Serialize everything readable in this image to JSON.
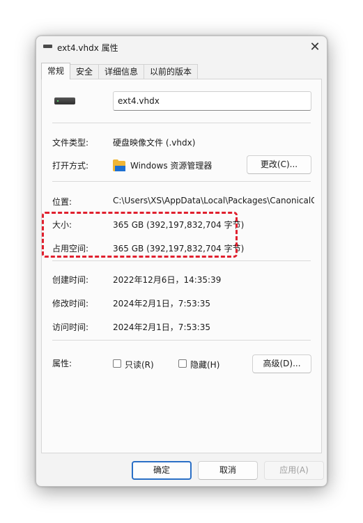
{
  "window": {
    "title": "ext4.vhdx 属性",
    "close_glyph": "✕"
  },
  "tabs": [
    {
      "label": "常规",
      "active": true
    },
    {
      "label": "安全",
      "active": false
    },
    {
      "label": "详细信息",
      "active": false
    },
    {
      "label": "以前的版本",
      "active": false
    }
  ],
  "general": {
    "file_name": "ext4.vhdx",
    "type_label": "文件类型:",
    "type_value": "硬盘映像文件 (.vhdx)",
    "open_with_label": "打开方式:",
    "open_with_value": "Windows 资源管理器",
    "change_button": "更改(C)...",
    "location_label": "位置:",
    "location_value": "C:\\Users\\XS\\AppData\\Local\\Packages\\CanonicalG",
    "size_label": "大小:",
    "size_value": "365 GB (392,197,832,704 字节)",
    "size_on_disk_label": "占用空间:",
    "size_on_disk_value": "365 GB (392,197,832,704 字节)",
    "created_label": "创建时间:",
    "created_value": "2022年12月6日，14:35:39",
    "modified_label": "修改时间:",
    "modified_value": "2024年2月1日，7:53:35",
    "accessed_label": "访问时间:",
    "accessed_value": "2024年2月1日，7:53:35",
    "attributes_label": "属性:",
    "readonly_label": "只读(R)",
    "hidden_label": "隐藏(H)",
    "advanced_button": "高级(D)..."
  },
  "footer": {
    "ok_button": "确定",
    "cancel_button": "取消",
    "apply_button": "应用(A)"
  },
  "colors": {
    "accent": "#005fb8",
    "highlight_border": "#e0202e",
    "disabled_text": "#a0a0a0"
  }
}
